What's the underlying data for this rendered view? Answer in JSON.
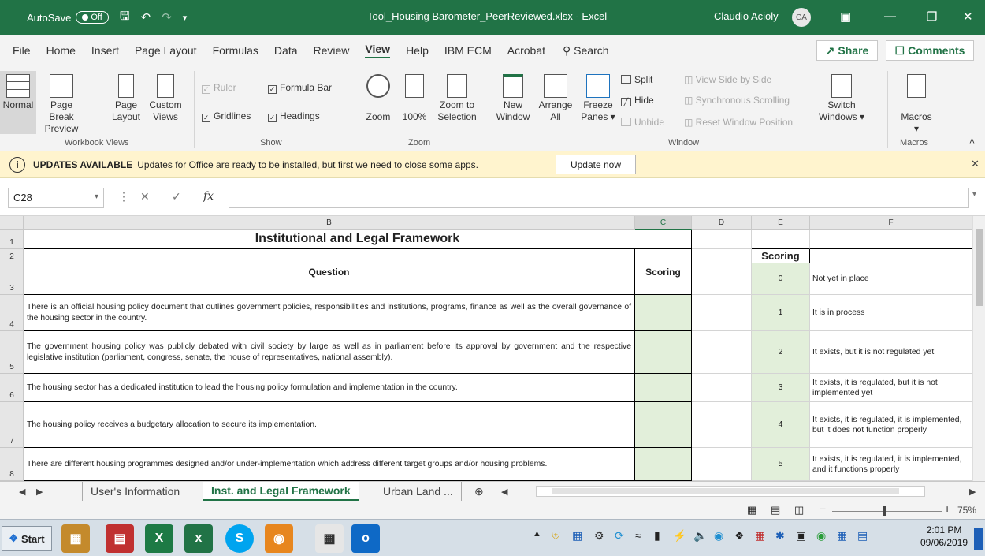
{
  "titlebar": {
    "autosave_label": "AutoSave",
    "autosave_state": "Off",
    "document_title": "Tool_Housing Barometer_PeerReviewed.xlsx  -  Excel",
    "user_name": "Claudio Acioly",
    "user_initials": "CA"
  },
  "menu": {
    "tabs": [
      "File",
      "Home",
      "Insert",
      "Page Layout",
      "Formulas",
      "Data",
      "Review",
      "View",
      "Help",
      "IBM ECM",
      "Acrobat"
    ],
    "active_tab": "View",
    "search_label": "Search",
    "share_label": "Share",
    "comments_label": "Comments"
  },
  "ribbon": {
    "normal": "Normal",
    "page_break_1": "Page Break",
    "page_break_2": "Preview",
    "page_layout_1": "Page",
    "page_layout_2": "Layout",
    "custom_views_1": "Custom",
    "custom_views_2": "Views",
    "group_workbook_views": "Workbook Views",
    "ruler": "Ruler",
    "formula_bar": "Formula Bar",
    "gridlines": "Gridlines",
    "headings": "Headings",
    "group_show": "Show",
    "zoom": "Zoom",
    "zoom_100": "100%",
    "zoom_to_1": "Zoom to",
    "zoom_to_2": "Selection",
    "group_zoom": "Zoom",
    "new_window_1": "New",
    "new_window_2": "Window",
    "arrange_1": "Arrange",
    "arrange_2": "All",
    "freeze_1": "Freeze",
    "freeze_2": "Panes",
    "split": "Split",
    "hide": "Hide",
    "unhide": "Unhide",
    "view_side": "View Side by Side",
    "sync_scroll": "Synchronous Scrolling",
    "reset_window": "Reset Window Position",
    "switch_1": "Switch",
    "switch_2": "Windows",
    "group_window": "Window",
    "macros": "Macros",
    "group_macros": "Macros"
  },
  "update_bar": {
    "title": "UPDATES AVAILABLE",
    "message": "Updates for Office are ready to be installed, but first we need to close some apps.",
    "button": "Update now"
  },
  "formula_bar": {
    "name_box": "C28",
    "fx": "fx",
    "value": ""
  },
  "columns": [
    "B",
    "C",
    "D",
    "E",
    "F"
  ],
  "rows": [
    "1",
    "2",
    "3",
    "4",
    "5",
    "6",
    "7",
    "8"
  ],
  "sheet": {
    "title": "Institutional and Legal Framework",
    "question_header": "Question",
    "scoring_header": "Scoring",
    "questions": [
      "There is an official housing policy document that outlines government policies, responsibilities and institutions, programs, finance as well as the overall governance of the housing sector in the country.",
      "The government housing policy was publicly debated with civil society by large as well as in parliament before its approval by government and the respective legislative institution (parliament, congress, senate, the house of representatives, national assembly).",
      "The housing sector has a dedicated institution to lead the housing policy formulation and implementation in the country.",
      "The housing policy receives a budgetary allocation to secure its implementation.",
      "There are different housing programmes designed and/or under-implementation which address different target groups and/or housing problems."
    ],
    "legend_header": "Scoring",
    "legend_scores": [
      "0",
      "1",
      "2",
      "3",
      "4",
      "5"
    ],
    "legend_texts": [
      "Not yet in place",
      "It is in process",
      "It exists, but it is not regulated yet",
      "It exists, it is regulated, but it is not implemented yet",
      "It exists, it is regulated, it is implemented, but it does not function properly",
      "It exists, it is regulated, it is implemented, and it functions properly"
    ]
  },
  "sheet_tabs": [
    "User's Information",
    "Inst. and Legal Framework",
    "Urban Land ..."
  ],
  "active_sheet": "Inst. and Legal Framework",
  "status": {
    "zoom": "75%"
  },
  "taskbar": {
    "start": "Start",
    "time": "2:01 PM",
    "date": "09/06/2019"
  }
}
